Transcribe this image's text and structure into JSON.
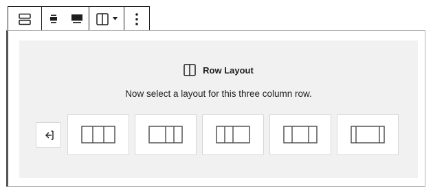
{
  "toolbar": {
    "groups": [
      {
        "buttons": [
          {
            "icon": "block-row-icon",
            "title": "Row"
          }
        ]
      },
      {
        "buttons": [
          {
            "icon": "align-center-icon",
            "title": "Align center"
          },
          {
            "icon": "align-full-width-icon",
            "title": "Full width"
          }
        ]
      },
      {
        "buttons": [
          {
            "icon": "columns-icon",
            "title": "Change layout"
          },
          {
            "icon": "caret-down-icon",
            "title": ""
          }
        ]
      },
      {
        "buttons": [
          {
            "icon": "more-options-icon",
            "title": "More options"
          }
        ]
      }
    ]
  },
  "placeholder": {
    "icon": "columns-icon",
    "title": "Row Layout",
    "instructions": "Now select a layout for this three column row.",
    "back_button": {
      "icon": "back-arrow-icon",
      "label": "Back"
    },
    "layouts": [
      {
        "label": "Equal",
        "icon": "layout-equal-icon"
      },
      {
        "label": "Left half",
        "icon": "layout-left-half-icon"
      },
      {
        "label": "Right half",
        "icon": "layout-right-half-icon"
      },
      {
        "label": "Center half",
        "icon": "layout-center-half-icon"
      },
      {
        "label": "Wide center",
        "icon": "layout-wide-center-icon"
      }
    ]
  },
  "colors": {
    "icon": "#1e1e1e",
    "placeholder_bg": "#f1f1f1",
    "border": "#d6d6d6",
    "block_accent": "#555555"
  }
}
